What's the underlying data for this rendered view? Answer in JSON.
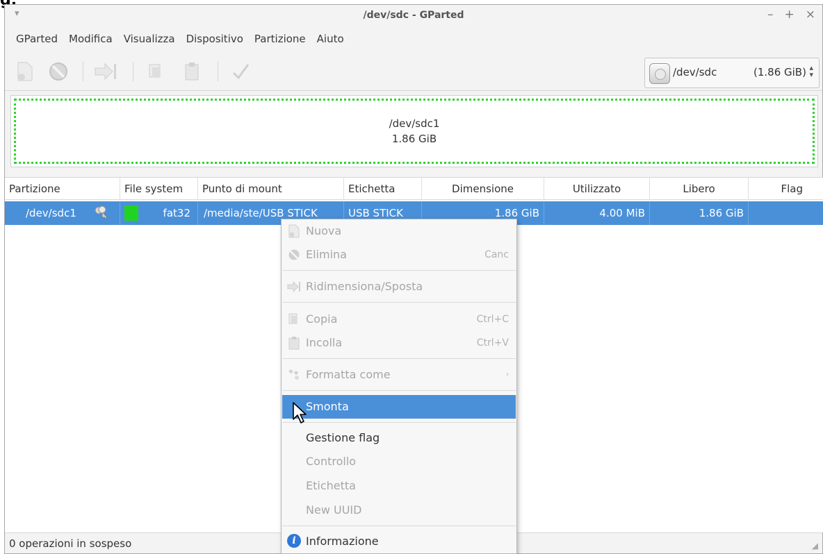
{
  "corner_glyph": "g.",
  "window": {
    "title": "/dev/sdc - GParted",
    "menu_arrow": "▾",
    "controls": {
      "minimize": "–",
      "maximize": "+",
      "close": "×"
    }
  },
  "menubar": [
    "GParted",
    "Modifica",
    "Visualizza",
    "Dispositivo",
    "Partizione",
    "Aiuto"
  ],
  "device_selector": {
    "device": "/dev/sdc",
    "size": "(1.86 GiB)"
  },
  "partition_graph": {
    "name": "/dev/sdc1",
    "size": "1.86 GiB",
    "border_color": "#2fd32f"
  },
  "table": {
    "columns": [
      "Partizione",
      "File system",
      "Punto di mount",
      "Etichetta",
      "Dimensione",
      "Utilizzato",
      "Libero",
      "Flag"
    ],
    "rows": [
      {
        "partition": "/dev/sdc1",
        "filesystem": "fat32",
        "filesystem_color": "#21d321",
        "mount_point": "/media/ste/USB STICK",
        "label": "USB STICK",
        "size": "1.86 GiB",
        "used": "4.00 MiB",
        "free": "1.86 GiB",
        "flags": ""
      }
    ]
  },
  "context_menu": {
    "items": [
      {
        "label": "Nuova",
        "icon": "new-partition-icon"
      },
      {
        "label": "Elimina",
        "shortcut": "Canc",
        "icon": "delete-icon"
      },
      {
        "label": "Ridimensiona/Sposta",
        "icon": "resize-move-icon"
      },
      {
        "label": "Copia",
        "shortcut": "Ctrl+C",
        "icon": "copy-icon"
      },
      {
        "label": "Incolla",
        "shortcut": "Ctrl+V",
        "icon": "paste-icon"
      },
      {
        "label": "Formatta come",
        "icon": "format-icon",
        "submenu_arrow": "›"
      },
      {
        "label": "Smonta"
      },
      {
        "label": "Gestione flag"
      },
      {
        "label": "Controllo"
      },
      {
        "label": "Etichetta"
      },
      {
        "label": "New UUID"
      },
      {
        "label": "Informazione",
        "icon": "info-icon",
        "icon_glyph": "i"
      }
    ]
  },
  "statusbar": {
    "text": "0 operazioni in sospeso"
  },
  "colors": {
    "selection": "#4a90d9",
    "accent_green": "#21d321"
  }
}
